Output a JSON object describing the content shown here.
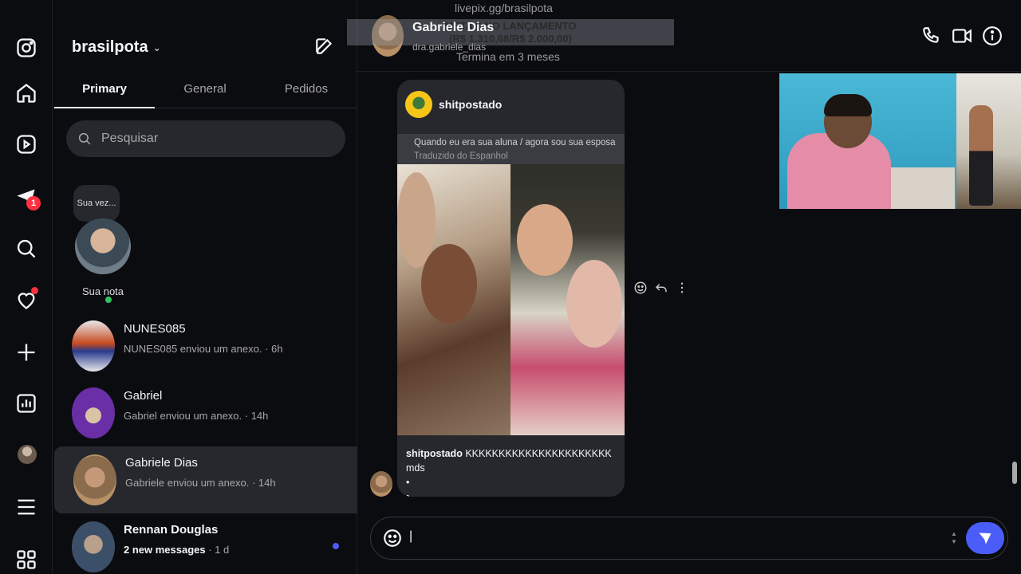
{
  "inbox": {
    "account_name": "brasilpota",
    "tabs": [
      "Primary",
      "General",
      "Pedidos"
    ],
    "search_placeholder": "Pesquisar",
    "note": {
      "bubble_text": "Sua vez...",
      "label": "Sua nota"
    },
    "threads": [
      {
        "name": "NUNES085",
        "preview": "NUNES085 enviou um anexo. · 6h",
        "unread": false
      },
      {
        "name": "Gabriel",
        "preview": "Gabriel enviou um anexo. · 14h",
        "unread": false
      },
      {
        "name": "Gabriele Dias",
        "preview": "Gabriele enviou um anexo. · 14h",
        "unread": false,
        "selected": true
      },
      {
        "name": "Rennan Douglas",
        "preview": "2 new messages",
        "time": " · 1 d",
        "unread": true
      }
    ]
  },
  "rail": {
    "icons": [
      "instagram-icon",
      "home-icon",
      "reels-icon",
      "messages-icon",
      "search-icon",
      "notifications-icon",
      "create-icon",
      "insights-icon",
      "profile-avatar",
      "more-icon",
      "threads-icon"
    ],
    "messages_badge": "1"
  },
  "chat": {
    "contact_name": "Gabriele Dias",
    "contact_username": "dra.gabriele_dias",
    "overlay": {
      "url": "livepix.gg/brasilpota",
      "line1": "META 6 NO LANÇAMENTO",
      "line2": "(R$ 1.310,68/R$ 2.000,00)",
      "ends": "Termina em 3 meses"
    },
    "shared_post": {
      "author": "shitpostado",
      "caption": "Quando eu era sua aluna / agora sou sua esposa",
      "translated": "Traduzido do Espanhol",
      "text_author": "shitpostado",
      "text": "KKKKKKKKKKKKKKKKKKKKKK mds",
      "text_line2": "•",
      "text_line3": "•..."
    },
    "composer_value": "",
    "composer_cursor": "|"
  },
  "colors": {
    "accent": "#4a5df9",
    "badge": "#ff3040",
    "online": "#33c45d",
    "panel": "#26282e",
    "background": "#0b0c10"
  }
}
